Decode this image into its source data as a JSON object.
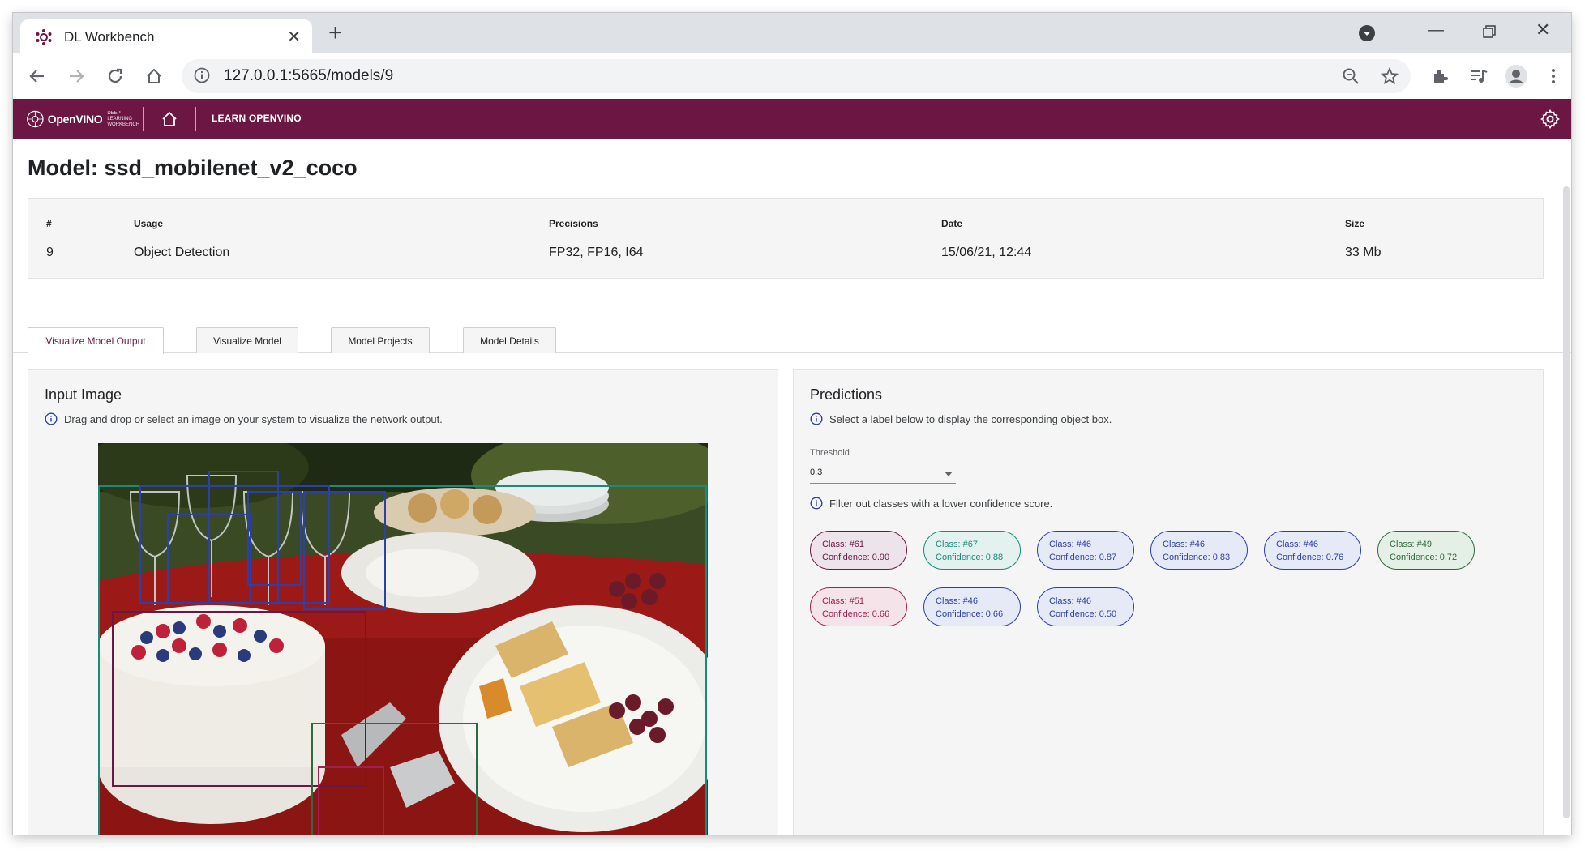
{
  "browser": {
    "tab_title": "DL Workbench",
    "url": "127.0.0.1:5665/models/9"
  },
  "app": {
    "logo_text": "OpenVINO",
    "logo_sub": "DEEP LEARNING WORKBENCH",
    "learn_link": "LEARN OPENVINO",
    "accent_color": "#6c1644"
  },
  "page": {
    "title": "Model: ssd_mobilenet_v2_coco"
  },
  "model_info": {
    "headers": [
      "#",
      "Usage",
      "Precisions",
      "Date",
      "Size"
    ],
    "values": [
      "9",
      "Object Detection",
      "FP32, FP16, I64",
      "15/06/21, 12:44",
      "33 Mb"
    ]
  },
  "tabs": [
    {
      "label": "Visualize Model Output"
    },
    {
      "label": "Visualize Model"
    },
    {
      "label": "Model Projects"
    },
    {
      "label": "Model Details"
    }
  ],
  "input_panel": {
    "title": "Input Image",
    "hint": "Drag and drop or select an image on your system to visualize the network output."
  },
  "predictions_panel": {
    "title": "Predictions",
    "hint": "Select a label below to display the corresponding object box.",
    "threshold_label": "Threshold",
    "threshold_value": "0.3",
    "filter_hint": "Filter out classes with a lower confidence score.",
    "chips": [
      {
        "class": "Class: #61",
        "confidence": "Confidence: 0.90",
        "color": "#6c1644",
        "bg": "#ece4ea"
      },
      {
        "class": "Class: #67",
        "confidence": "Confidence: 0.88",
        "color": "#1a8a7a",
        "bg": "#e3f1ef"
      },
      {
        "class": "Class: #46",
        "confidence": "Confidence: 0.87",
        "color": "#2d3fa8",
        "bg": "#e6e9f6"
      },
      {
        "class": "Class: #46",
        "confidence": "Confidence: 0.83",
        "color": "#2d3fa8",
        "bg": "#e6e9f6"
      },
      {
        "class": "Class: #46",
        "confidence": "Confidence: 0.76",
        "color": "#2d3fa8",
        "bg": "#e6e9f6"
      },
      {
        "class": "Class: #49",
        "confidence": "Confidence: 0.72",
        "color": "#2f6b3a",
        "bg": "#e4efe6"
      },
      {
        "class": "Class: #51",
        "confidence": "Confidence: 0.66",
        "color": "#a02050",
        "bg": "#f4e4ea"
      },
      {
        "class": "Class: #46",
        "confidence": "Confidence: 0.66",
        "color": "#2d3fa8",
        "bg": "#e6e9f6"
      },
      {
        "class": "Class: #46",
        "confidence": "Confidence: 0.50",
        "color": "#2d3fa8",
        "bg": "#e6e9f6"
      }
    ]
  }
}
